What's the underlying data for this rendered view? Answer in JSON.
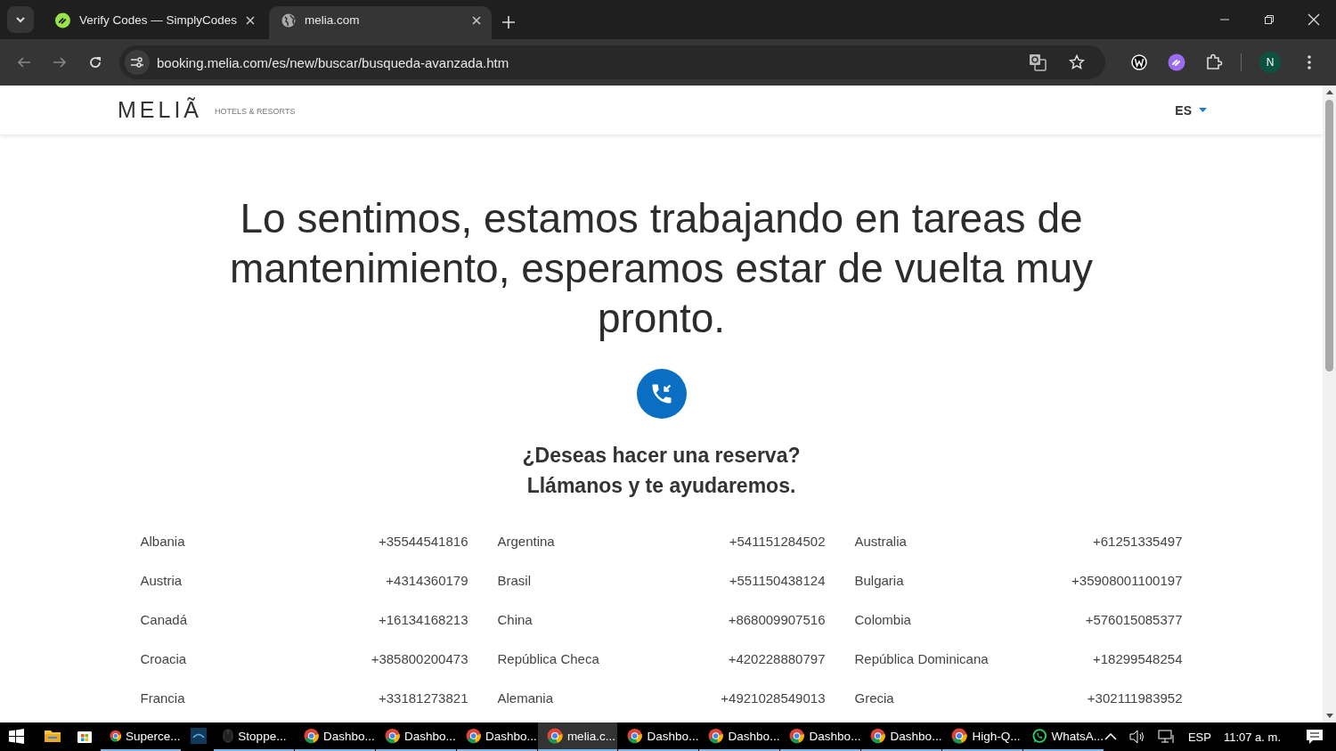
{
  "browser": {
    "tabs": [
      {
        "title": "Verify Codes — SimplyCodes",
        "selected": false
      },
      {
        "title": "melia.com",
        "selected": true
      }
    ],
    "url": "booking.melia.com/es/new/buscar/busqueda-avanzada.htm",
    "profile": "N"
  },
  "header": {
    "logo": "MELIÃ",
    "tagline": "HOTELS & RESORTS",
    "language": "ES"
  },
  "message": {
    "heading": "Lo sentimos, estamos trabajando en tareas de mantenimiento, esperamos estar de vuelta muy pronto.",
    "question": "¿Deseas hacer una reserva?",
    "call": "Llámanos y te ayudaremos."
  },
  "contacts": [
    {
      "country": "Albania",
      "phone": "+35544541816"
    },
    {
      "country": "Argentina",
      "phone": "+541151284502"
    },
    {
      "country": "Australia",
      "phone": "+61251335497"
    },
    {
      "country": "Austria",
      "phone": "+4314360179"
    },
    {
      "country": "Brasil",
      "phone": "+551150438124"
    },
    {
      "country": "Bulgaria",
      "phone": "+35908001100197"
    },
    {
      "country": "Canadá",
      "phone": "+16134168213"
    },
    {
      "country": "China",
      "phone": "+868009907516"
    },
    {
      "country": "Colombia",
      "phone": "+576015085377"
    },
    {
      "country": "Croacia",
      "phone": "+385800200473"
    },
    {
      "country": "República Checa",
      "phone": "+420228880797"
    },
    {
      "country": "República Dominicana",
      "phone": "+18299548254"
    },
    {
      "country": "Francia",
      "phone": "+33181273821"
    },
    {
      "country": "Alemania",
      "phone": "+4921028549013"
    },
    {
      "country": "Grecia",
      "phone": "+302111983952"
    }
  ],
  "taskbar": {
    "items": [
      {
        "kind": "folder",
        "selected": false
      },
      {
        "kind": "store",
        "selected": false
      },
      {
        "kind": "chrome",
        "label": "Superce...",
        "selected": false
      },
      {
        "kind": "tv",
        "selected": false
      },
      {
        "kind": "mouse",
        "label": "Stoppe...",
        "selected": false
      },
      {
        "kind": "chrome",
        "label": "Dashbo...",
        "selected": false
      },
      {
        "kind": "chrome",
        "label": "Dashbo...",
        "selected": false
      },
      {
        "kind": "chrome",
        "label": "Dashbo...",
        "selected": false
      },
      {
        "kind": "chrome",
        "label": "melia.c...",
        "selected": true
      },
      {
        "kind": "chrome",
        "label": "Dashbo...",
        "selected": false
      },
      {
        "kind": "chrome",
        "label": "Dashbo...",
        "selected": false
      },
      {
        "kind": "chrome",
        "label": "Dashbo...",
        "selected": false
      },
      {
        "kind": "chrome",
        "label": "Dashbo...",
        "selected": false
      },
      {
        "kind": "chrome",
        "label": "High-Q...",
        "selected": false
      },
      {
        "kind": "whatsapp",
        "label": "WhatsA...",
        "selected": false
      }
    ],
    "language": "ESP",
    "time": "11:07 a. m."
  }
}
